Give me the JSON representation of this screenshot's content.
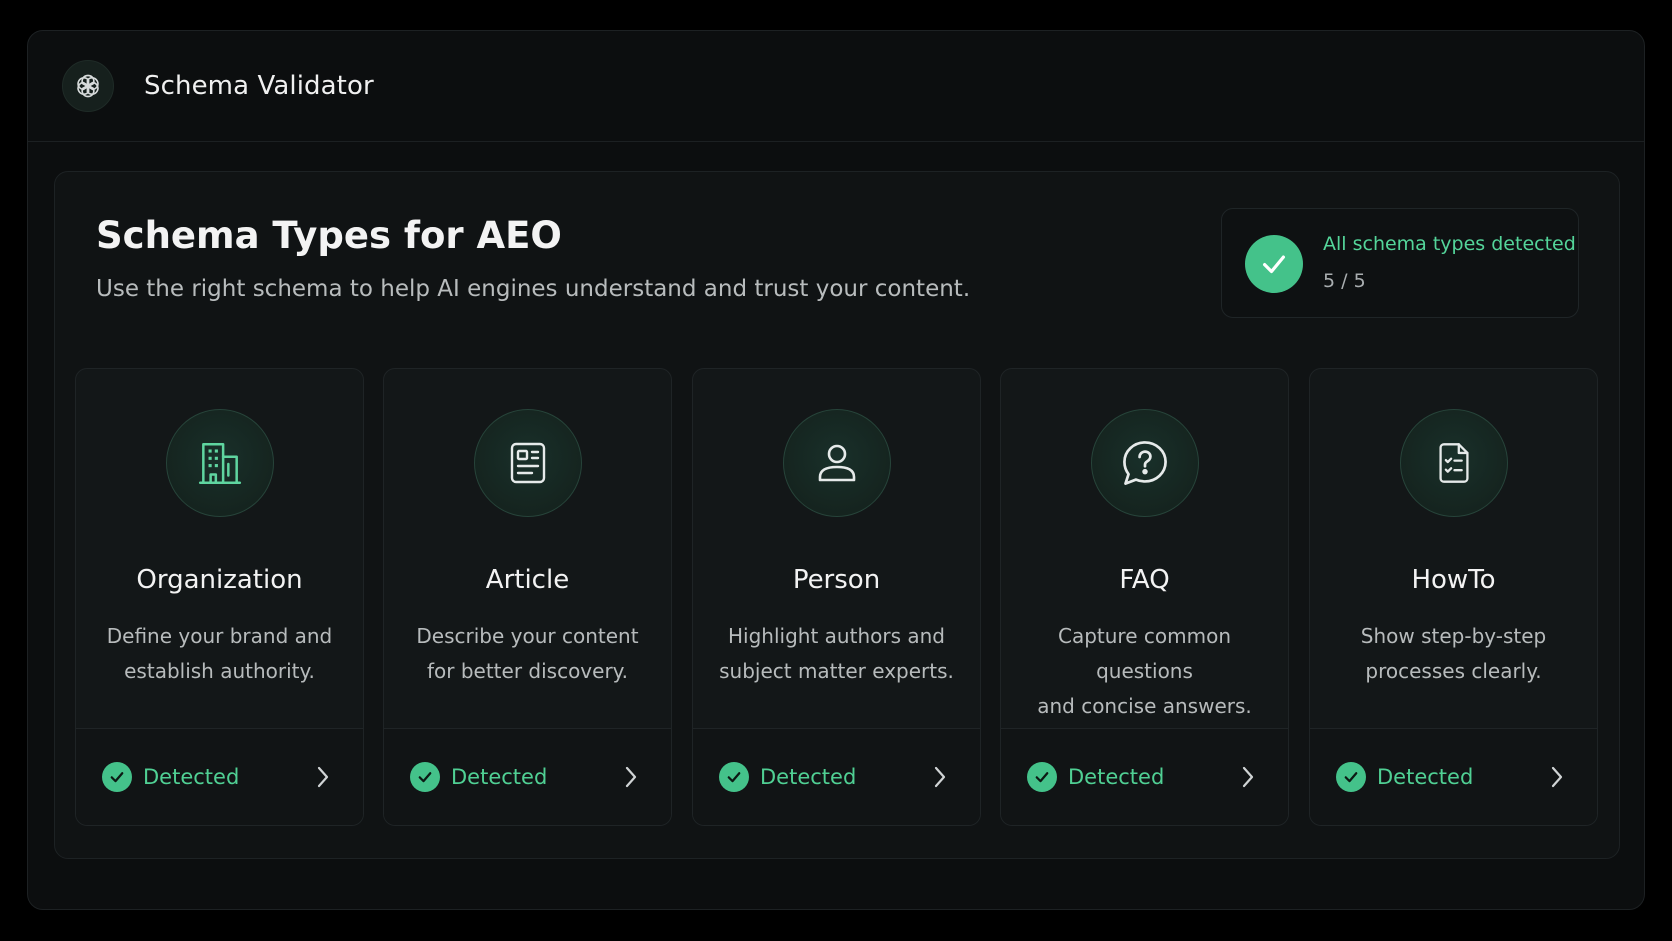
{
  "header": {
    "title": "Schema Validator",
    "logo_icon": "openai-logo-icon"
  },
  "panel": {
    "title": "Schema Types for AEO",
    "subtitle": "Use the right schema to help AI engines understand and trust your content."
  },
  "status": {
    "label": "All schema types detected",
    "count": "5 / 5",
    "icon": "check-circle-icon"
  },
  "cards": [
    {
      "title": "Organization",
      "desc_line1": "Define your brand and",
      "desc_line2": "establish authority.",
      "icon": "building-icon",
      "status": "Detected"
    },
    {
      "title": "Article",
      "desc_line1": "Describe your content",
      "desc_line2": "for better discovery.",
      "icon": "newspaper-icon",
      "status": "Detected"
    },
    {
      "title": "Person",
      "desc_line1": "Highlight authors and",
      "desc_line2": "subject matter experts.",
      "icon": "user-icon",
      "status": "Detected"
    },
    {
      "title": "FAQ",
      "desc_line1": "Capture common questions",
      "desc_line2": "and concise answers.",
      "icon": "question-bubble-icon",
      "status": "Detected"
    },
    {
      "title": "HowTo",
      "desc_line1": "Show step-by-step",
      "desc_line2": "processes clearly.",
      "icon": "checklist-document-icon",
      "status": "Detected"
    }
  ],
  "colors": {
    "accent": "#44c28a",
    "accent_text": "#54d59a",
    "background": "#0c0e0f",
    "card": "#131718"
  }
}
